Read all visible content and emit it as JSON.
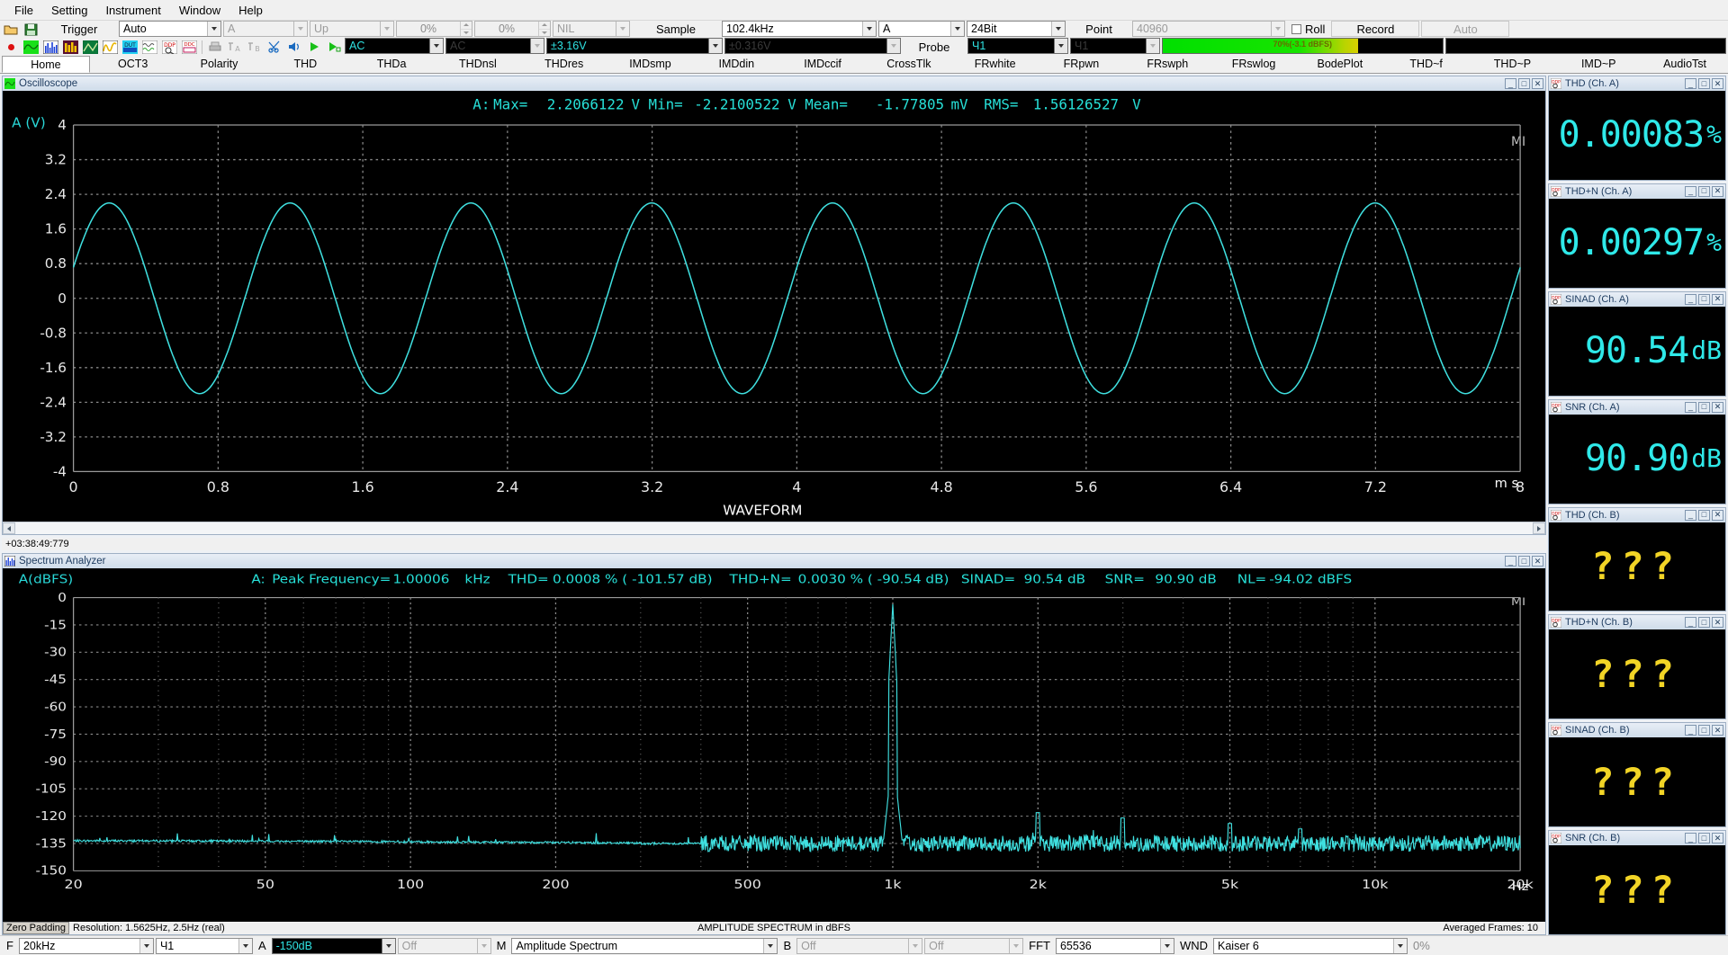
{
  "menu": [
    "File",
    "Setting",
    "Instrument",
    "Window",
    "Help"
  ],
  "toolbar1": {
    "trigger_label": "Trigger",
    "trigger_mode": "Auto",
    "trigger_channel": "A",
    "trigger_slope": "Up",
    "trigger_level": "0%",
    "trigger_pos": "0%",
    "trigger_hold": "NIL",
    "sample_label": "Sample",
    "sample_rate": "102.4kHz",
    "input_channel": "A",
    "bit_depth": "24Bit",
    "point_label": "Point",
    "point_value": "40960",
    "roll_label": "Roll",
    "record_label": "Record",
    "auto_label": "Auto"
  },
  "toolbar2": {
    "coupling_a": "AC",
    "coupling_b": "AC",
    "range_a": "±3.16V",
    "range_b": "±0.316V",
    "probe_label": "Probe",
    "probe_a": "Ч1",
    "probe_b": "Ч1",
    "meter_value": "70%(-3.1 dBFS)",
    "meter_percent": 70
  },
  "tabs": [
    {
      "label": "Home",
      "active": true
    },
    {
      "label": "OCT3",
      "active": false
    },
    {
      "label": "Polarity",
      "active": false
    },
    {
      "label": "THD",
      "active": false
    },
    {
      "label": "THDa",
      "active": false
    },
    {
      "label": "THDnsl",
      "active": false
    },
    {
      "label": "THDres",
      "active": false
    },
    {
      "label": "IMDsmp",
      "active": false
    },
    {
      "label": "IMDdin",
      "active": false
    },
    {
      "label": "IMDccif",
      "active": false
    },
    {
      "label": "CrossTlk",
      "active": false
    },
    {
      "label": "FRwhite",
      "active": false
    },
    {
      "label": "FRpwn",
      "active": false
    },
    {
      "label": "FRswph",
      "active": false
    },
    {
      "label": "FRswlog",
      "active": false
    },
    {
      "label": "BodePlot",
      "active": false
    },
    {
      "label": "THD~f",
      "active": false
    },
    {
      "label": "THD~P",
      "active": false
    },
    {
      "label": "IMD~P",
      "active": false
    },
    {
      "label": "AudioTst",
      "active": false
    }
  ],
  "scope": {
    "title": "Oscilloscope",
    "readout": "A: Max=   2.2066122  V Min=  -2.2100522  V Mean=   -1.77805 mV RMS=  1.56126527   V",
    "readout_parts": {
      "ch": "A:",
      "max_label": "Max=",
      "max_value": "2.2066122",
      "max_unit": "V",
      "min_label": "Min=",
      "min_value": "-2.2100522",
      "min_unit": "V",
      "mean_label": "Mean=",
      "mean_value": "-1.77805",
      "mean_unit": "mV",
      "rms_label": "RMS=",
      "rms_value": "1.56126527",
      "rms_unit": "V"
    },
    "yaxis_label": "A (V)",
    "corner_label": "MI",
    "yticks": [
      "4",
      "3.2",
      "2.4",
      "1.6",
      "0.8",
      "0",
      "-0.8",
      "-1.6",
      "-2.4",
      "-3.2",
      "-4"
    ],
    "xticks": [
      "0",
      "0.8",
      "1.6",
      "2.4",
      "3.2",
      "4",
      "4.8",
      "5.6",
      "6.4",
      "7.2",
      "8"
    ],
    "xunit": "m s",
    "footer_center": "WAVEFORM",
    "timestamp": "+03:38:49:779",
    "wave": {
      "amplitude": 2.2,
      "cycles": 8,
      "phase": 0
    }
  },
  "spectrum": {
    "title": "Spectrum Analyzer",
    "yaxis_label": "A(dBFS)",
    "corner_label": "MI",
    "readout_parts": {
      "ch": "A:",
      "peak_label": "Peak Frequency=",
      "peak_value": "1.00006",
      "peak_unit": "kHz",
      "thd_label": "THD=",
      "thd_value": "0.0008 % (  -101.57 dB)",
      "thdn_label": "THD+N=",
      "thdn_value": "0.0030 % (  -90.54 dB)",
      "sinad_label": "SINAD=",
      "sinad_value": "90.54 dB",
      "snr_label": "SNR=",
      "snr_value": "90.90 dB",
      "nl_label": "NL=",
      "nl_value": "-94.02 dBFS"
    },
    "yticks": [
      "0",
      "-15",
      "-30",
      "-45",
      "-60",
      "-75",
      "-90",
      "-105",
      "-120",
      "-135",
      "-150"
    ],
    "xticks": [
      "20",
      "50",
      "100",
      "200",
      "500",
      "1k",
      "2k",
      "5k",
      "10k",
      "20k"
    ],
    "xunit": "Hz",
    "footer_left_badge": "Zero Padding",
    "footer_resolution": "Resolution: 1.5625Hz, 2.5Hz (real)",
    "footer_center": "AMPLITUDE SPECTRUM in dBFS",
    "footer_right": "Averaged Frames: 10",
    "noise_floor_db": -135,
    "peak_db": -3.1
  },
  "meters": [
    {
      "title": "THD (Ch. A)",
      "value": "0.00083",
      "unit": "%",
      "unknown": false
    },
    {
      "title": "THD+N (Ch. A)",
      "value": "0.00297",
      "unit": "%",
      "unknown": false
    },
    {
      "title": "SINAD (Ch. A)",
      "value": "90.54",
      "unit": "dB",
      "unknown": false
    },
    {
      "title": "SNR (Ch. A)",
      "value": "90.90",
      "unit": "dB",
      "unknown": false
    },
    {
      "title": "THD (Ch. B)",
      "value": "???",
      "unit": "",
      "unknown": true
    },
    {
      "title": "THD+N (Ch. B)",
      "value": "???",
      "unit": "",
      "unknown": true
    },
    {
      "title": "SINAD (Ch. B)",
      "value": "???",
      "unit": "",
      "unknown": true
    },
    {
      "title": "SNR (Ch. B)",
      "value": "???",
      "unit": "",
      "unknown": true
    }
  ],
  "bottombar": {
    "f_label": "F",
    "f_value": "20kHz",
    "f_probe": "Ч1",
    "a_label": "A",
    "a_value": "-150dB",
    "a_mode": "Off",
    "m_label": "M",
    "m_value": "Amplitude Spectrum",
    "b_label": "B",
    "b_value": "Off",
    "b_mode": "Off",
    "fft_label": "FFT",
    "fft_value": "65536",
    "wnd_label": "WND",
    "wnd_value": "Kaiser 6",
    "pct_value": "0%"
  },
  "colors": {
    "trace": "#3fe0e0",
    "readout": "#27e0d8",
    "meter_value": "#2fe9e9",
    "unknown": "#f2d426",
    "accent_green": "#00e000",
    "plot_bg": "#000000"
  }
}
